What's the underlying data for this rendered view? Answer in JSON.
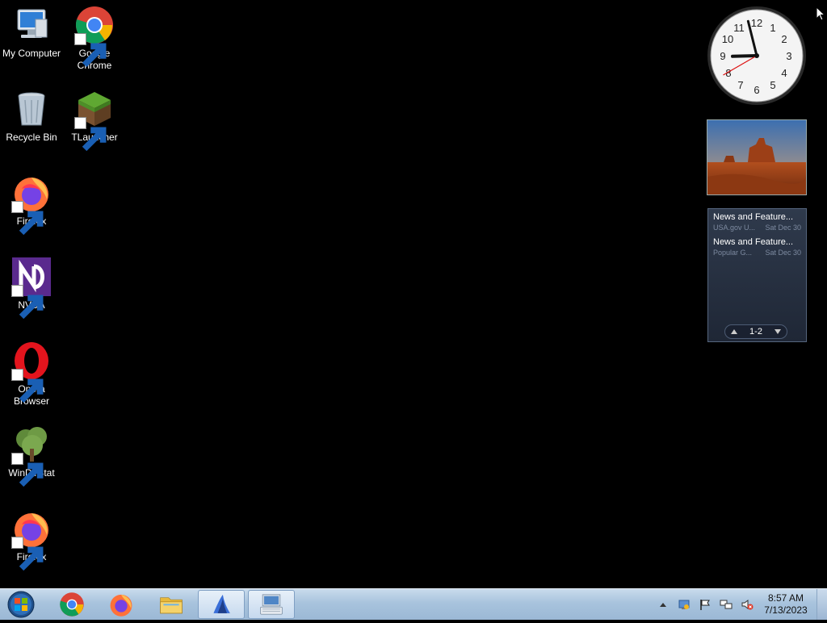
{
  "desktop": {
    "icons": [
      {
        "label": "My Computer",
        "icon": "computer-icon"
      },
      {
        "label": "Google Chrome",
        "icon": "chrome-icon"
      },
      {
        "label": "Recycle Bin",
        "icon": "recycle-bin-icon"
      },
      {
        "label": "TLauncher",
        "icon": "tlauncher-icon"
      },
      {
        "label": "Firefox",
        "icon": "firefox-icon"
      },
      {
        "label": "NVDA",
        "icon": "nvda-icon"
      },
      {
        "label": "Opera Browser",
        "icon": "opera-icon"
      },
      {
        "label": "WinDirStat",
        "icon": "windirstat-icon"
      },
      {
        "label": "Firefox",
        "icon": "firefox-icon"
      }
    ]
  },
  "gadgets": {
    "clock": {
      "hour": 8,
      "minute": 57,
      "second": 40
    },
    "feed": {
      "items": [
        {
          "title": "News and Feature...",
          "source": "USA.gov U...",
          "date": "Sat Dec 30"
        },
        {
          "title": "News and Feature...",
          "source": "Popular G...",
          "date": "Sat Dec 30"
        }
      ],
      "page": "1-2"
    }
  },
  "taskbar": {
    "pinned": [
      "start-orb",
      "chrome-icon",
      "firefox-icon",
      "explorer-icon",
      "nvda-app-icon",
      "onscreen-keyboard-icon"
    ],
    "tray": {
      "icons": [
        "show-hidden-icon",
        "network-config-icon",
        "action-center-flag-icon",
        "network-icon",
        "volume-muted-icon"
      ],
      "time": "8:57 AM",
      "date": "7/13/2023"
    }
  },
  "colors": {
    "desktop_bg": "#000000",
    "taskbar": "#a8c3dd"
  }
}
